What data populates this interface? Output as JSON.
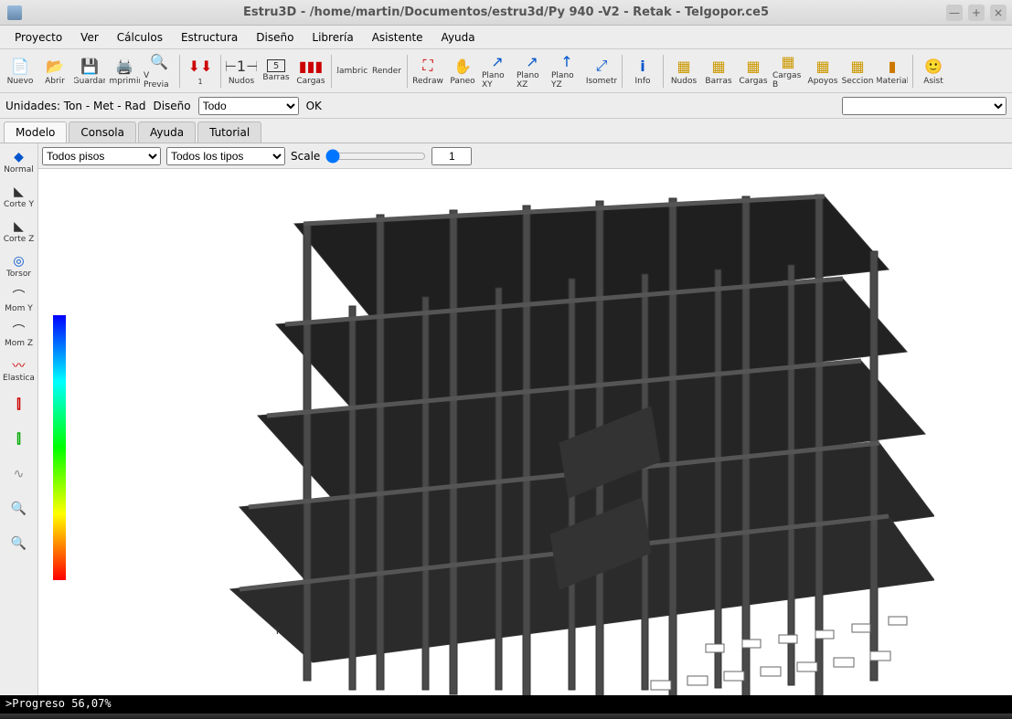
{
  "window": {
    "title": "Estru3D - /home/martin/Documentos/estru3d/Py 940 -V2 - Retak - Telgopor.ce5",
    "min": "—",
    "max": "+",
    "close": "×"
  },
  "menu": {
    "proyecto": "Proyecto",
    "ver": "Ver",
    "calculos": "Cálculos",
    "estructura": "Estructura",
    "diseno": "Diseño",
    "libreria": "Librería",
    "asistente": "Asistente",
    "ayuda": "Ayuda"
  },
  "toolbar": {
    "nuevo": "Nuevo",
    "abrir": "Abrir",
    "guardar": "Guardar",
    "imprimir": "Imprimir",
    "vprevia": "V Previa",
    "nudos": "Nudos",
    "barras": "Barras",
    "cargas": "Cargas",
    "alambrico": "Alambrico",
    "render": "Render",
    "redraw": "Redraw",
    "paneo": "Paneo",
    "planoxy": "Plano XY",
    "planoxz": "Plano XZ",
    "planoyz": "Plano YZ",
    "isometrica": "Isometr",
    "info": "Info",
    "nudos2": "Nudos",
    "barras2": "Barras",
    "cargas2": "Cargas",
    "cargasb": "Cargas B",
    "apoyos": "Apoyos",
    "seccion": "Seccion",
    "material": "Material",
    "asist": "Asist"
  },
  "subbar": {
    "unidades": "Unidades: Ton - Met - Rad",
    "diseno_label": "Diseño",
    "diseno_sel": "Todo",
    "ok": "OK"
  },
  "tabs": {
    "modelo": "Modelo",
    "consola": "Consola",
    "ayuda": "Ayuda",
    "tutorial": "Tutorial"
  },
  "left": {
    "normal": "Normal",
    "cortey": "Corte Y",
    "cortez": "Corte Z",
    "torsor": "Torsor",
    "momy": "Mom Y",
    "momz": "Mom Z",
    "elastica": "Elastica"
  },
  "options": {
    "pisos": "Todos pisos",
    "tipos": "Todos los tipos",
    "scale_label": "Scale",
    "scale_value": "1"
  },
  "viewport": {
    "axis_y": "Y"
  },
  "status": {
    "text": ">Progreso 56,07%"
  }
}
